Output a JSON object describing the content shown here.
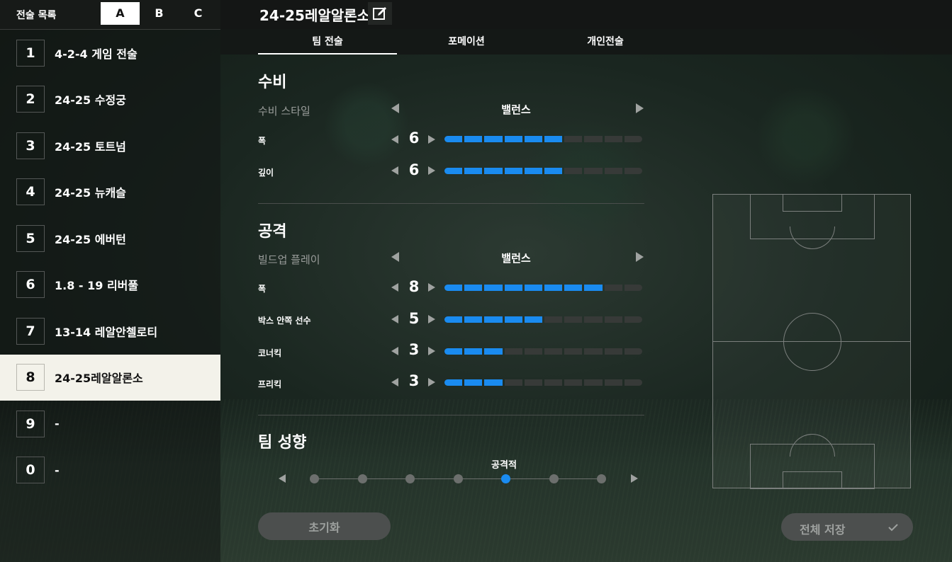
{
  "sidebar": {
    "title": "전술 목록",
    "presets": [
      "A",
      "B",
      "C"
    ],
    "active_preset": "A",
    "items": [
      {
        "num": "1",
        "name": "4-2-4 게임 전술"
      },
      {
        "num": "2",
        "name": "24-25 수정궁"
      },
      {
        "num": "3",
        "name": "24-25 토트넘"
      },
      {
        "num": "4",
        "name": "24-25 뉴캐슬"
      },
      {
        "num": "5",
        "name": "24-25 에버턴"
      },
      {
        "num": "6",
        "name": "1.8 - 19 리버풀"
      },
      {
        "num": "7",
        "name": "13-14 레알안첼로티"
      },
      {
        "num": "8",
        "name": "24-25레알알론소"
      },
      {
        "num": "9",
        "name": "-"
      },
      {
        "num": "0",
        "name": "-"
      }
    ],
    "selected_index": 7
  },
  "header": {
    "title": "24-25레알알론소",
    "edit_icon": "edit-icon"
  },
  "tabs": [
    {
      "label": "팀 전술",
      "active": true
    },
    {
      "label": "포메이션",
      "active": false
    },
    {
      "label": "개인전술",
      "active": false
    }
  ],
  "defense": {
    "title": "수비",
    "style_label": "수비 스타일",
    "style_value": "밸런스",
    "width_label": "폭",
    "width_value": "6",
    "width_level": 6,
    "depth_label": "깊이",
    "depth_value": "6",
    "depth_level": 6
  },
  "attack": {
    "title": "공격",
    "buildup_label": "빌드업 플레이",
    "buildup_value": "밸런스",
    "width_label": "폭",
    "width_value": "8",
    "width_level": 8,
    "box_label": "박스 안쪽 선수",
    "box_value": "5",
    "box_level": 5,
    "corner_label": "코너킥",
    "corner_value": "3",
    "corner_level": 3,
    "freekick_label": "프리킥",
    "freekick_value": "3",
    "freekick_level": 3
  },
  "tendency": {
    "title": "팀 성향",
    "value_label": "공격적",
    "position": 5,
    "steps": 7
  },
  "buttons": {
    "reset": "초기화",
    "save_all": "전체 저장"
  },
  "colors": {
    "accent": "#1a8bf0",
    "selected_row": "#f3f2ea"
  }
}
